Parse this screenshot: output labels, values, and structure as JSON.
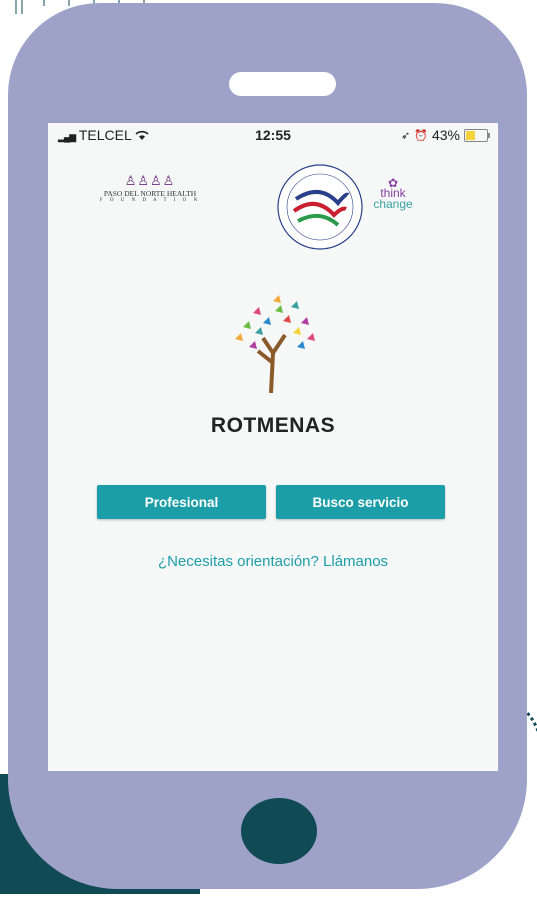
{
  "status_bar": {
    "carrier": "TELCEL",
    "time": "12:55",
    "battery": "43%",
    "battery_level": 0.43,
    "icons": [
      "signal-icon",
      "wifi-icon",
      "location-icon",
      "alarm-icon",
      "battery-charging-icon"
    ]
  },
  "logos": {
    "left": {
      "name": "PASO DEL NORTE HEALTH",
      "sub": "F O U N D A T I O N"
    },
    "right": {
      "line1": "think",
      "line2": "change"
    }
  },
  "app": {
    "name": "ROTMENAS",
    "buttons": {
      "professional": "Profesional",
      "seek_service": "Busco servicio"
    },
    "help_link": "¿Necesitas orientación? Llámanos"
  },
  "colors": {
    "phone_body": "#9ea2c9",
    "accent": "#1b9ea8",
    "dark_teal": "#0f4a55",
    "screen_bg": "#f6f8f8"
  }
}
